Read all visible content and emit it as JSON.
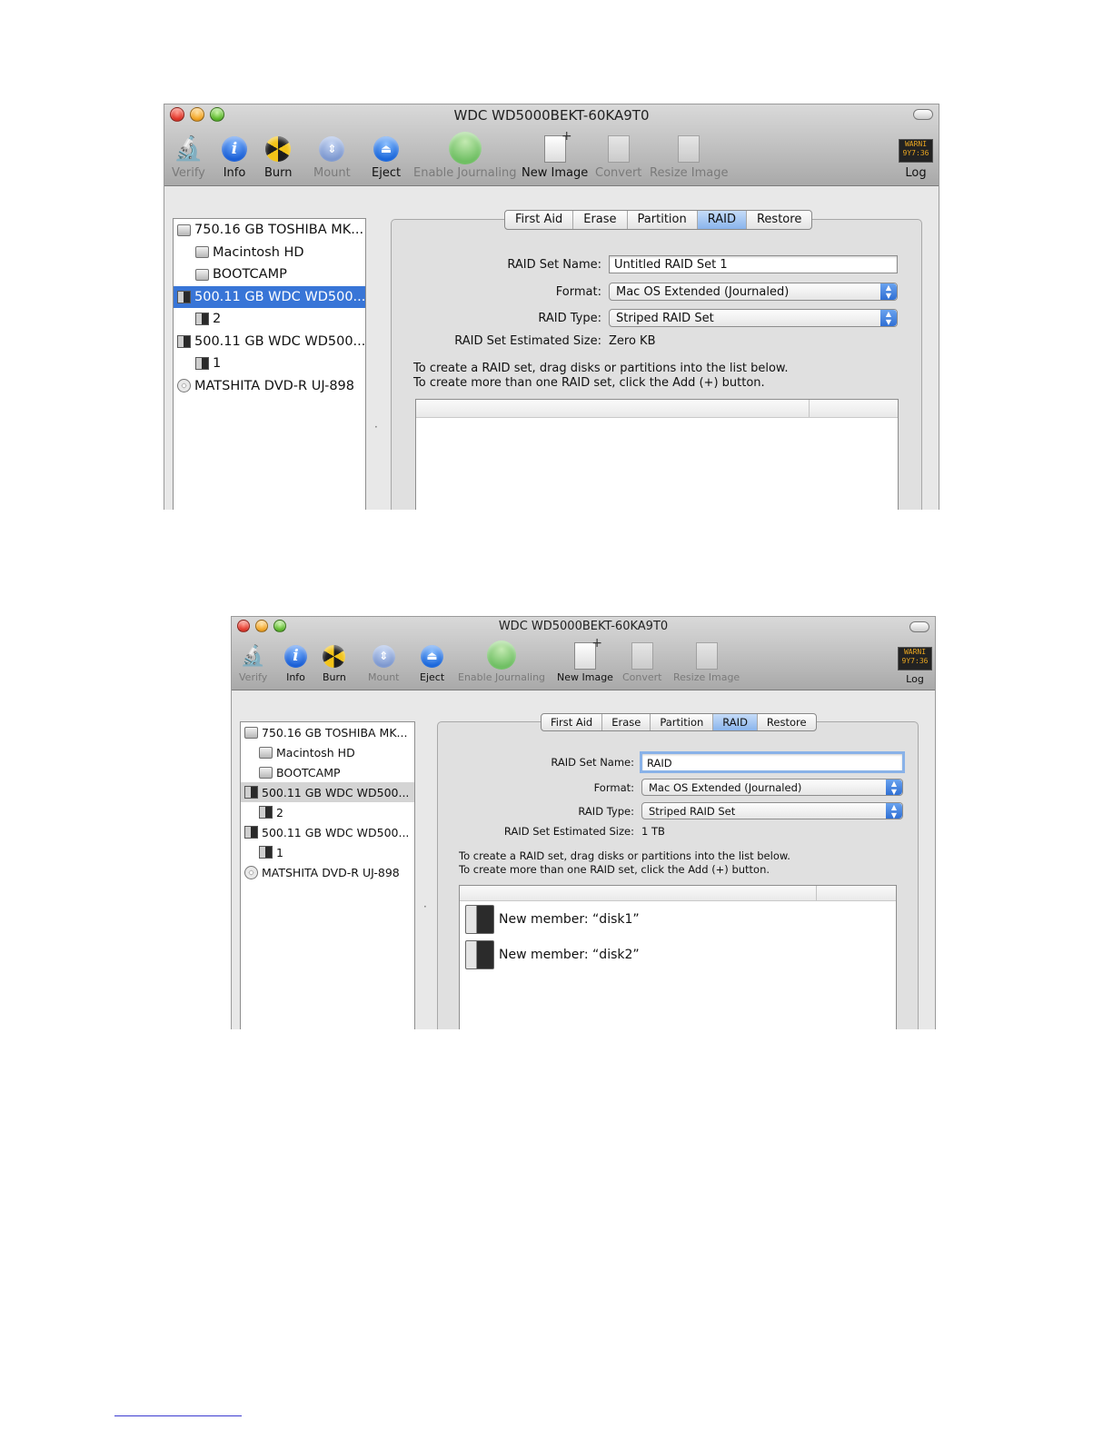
{
  "window1": {
    "title": "WDC WD5000BEKT-60KA9T0",
    "toolbar": [
      {
        "label": "Verify",
        "icon": "microscope-icon",
        "enabled": false
      },
      {
        "label": "Info",
        "icon": "info-icon",
        "enabled": true
      },
      {
        "label": "Burn",
        "icon": "burn-icon",
        "enabled": true
      },
      {
        "label": "Mount",
        "icon": "mount-icon",
        "enabled": false
      },
      {
        "label": "Eject",
        "icon": "eject-icon",
        "enabled": true
      },
      {
        "label": "Enable Journaling",
        "icon": "journaling-icon",
        "enabled": false
      },
      {
        "label": "New Image",
        "icon": "new-image-icon",
        "enabled": true
      },
      {
        "label": "Convert",
        "icon": "convert-icon",
        "enabled": false
      },
      {
        "label": "Resize Image",
        "icon": "resize-image-icon",
        "enabled": false
      },
      {
        "label": "Log",
        "icon": "log-icon",
        "enabled": true
      }
    ],
    "log_icon_text": "WARNI\n9Y7:36",
    "sidebar": [
      {
        "label": "750.16 GB TOSHIBA MK...",
        "icon": "internal-disk-icon",
        "indent": false,
        "selected": false
      },
      {
        "label": "Macintosh HD",
        "icon": "volume-icon",
        "indent": true,
        "selected": false
      },
      {
        "label": "BOOTCAMP",
        "icon": "volume-icon",
        "indent": true,
        "selected": false
      },
      {
        "label": "500.11 GB WDC WD500...",
        "icon": "external-disk-icon",
        "indent": false,
        "selected": true
      },
      {
        "label": "2",
        "icon": "external-volume-icon",
        "indent": true,
        "selected": false
      },
      {
        "label": "500.11 GB WDC WD500...",
        "icon": "external-disk-icon",
        "indent": false,
        "selected": false
      },
      {
        "label": "1",
        "icon": "external-volume-icon",
        "indent": true,
        "selected": false
      },
      {
        "label": "MATSHITA DVD-R UJ-898",
        "icon": "optical-disc-icon",
        "indent": false,
        "selected": false
      }
    ],
    "tabs": [
      "First Aid",
      "Erase",
      "Partition",
      "RAID",
      "Restore"
    ],
    "active_tab": "RAID",
    "raid": {
      "set_name_label": "RAID Set Name:",
      "set_name_value": "Untitled RAID Set 1",
      "format_label": "Format:",
      "format_value": "Mac OS Extended (Journaled)",
      "type_label": "RAID Type:",
      "type_value": "Striped RAID Set",
      "size_label": "RAID Set Estimated Size:",
      "size_value": "Zero KB",
      "help_line1": "To create a RAID set, drag disks or partitions into the list below.",
      "help_line2": "To create more than one RAID set, click the Add (+) button.",
      "members": []
    }
  },
  "window2": {
    "title": "WDC WD5000BEKT-60KA9T0",
    "toolbar": [
      {
        "label": "Verify",
        "icon": "microscope-icon",
        "enabled": false
      },
      {
        "label": "Info",
        "icon": "info-icon",
        "enabled": true
      },
      {
        "label": "Burn",
        "icon": "burn-icon",
        "enabled": true
      },
      {
        "label": "Mount",
        "icon": "mount-icon",
        "enabled": false
      },
      {
        "label": "Eject",
        "icon": "eject-icon",
        "enabled": true
      },
      {
        "label": "Enable Journaling",
        "icon": "journaling-icon",
        "enabled": false
      },
      {
        "label": "New Image",
        "icon": "new-image-icon",
        "enabled": true
      },
      {
        "label": "Convert",
        "icon": "convert-icon",
        "enabled": false
      },
      {
        "label": "Resize Image",
        "icon": "resize-image-icon",
        "enabled": false
      },
      {
        "label": "Log",
        "icon": "log-icon",
        "enabled": true
      }
    ],
    "log_icon_text": "WARNI\n9Y7:36",
    "sidebar": [
      {
        "label": "750.16 GB TOSHIBA MK...",
        "icon": "internal-disk-icon",
        "indent": false,
        "selected": false
      },
      {
        "label": "Macintosh HD",
        "icon": "volume-icon",
        "indent": true,
        "selected": false
      },
      {
        "label": "BOOTCAMP",
        "icon": "volume-icon",
        "indent": true,
        "selected": false
      },
      {
        "label": "500.11 GB WDC WD500...",
        "icon": "external-disk-icon",
        "indent": false,
        "selected": true
      },
      {
        "label": "2",
        "icon": "external-volume-icon",
        "indent": true,
        "selected": false
      },
      {
        "label": "500.11 GB WDC WD500...",
        "icon": "external-disk-icon",
        "indent": false,
        "selected": false
      },
      {
        "label": "1",
        "icon": "external-volume-icon",
        "indent": true,
        "selected": false
      },
      {
        "label": "MATSHITA DVD-R UJ-898",
        "icon": "optical-disc-icon",
        "indent": false,
        "selected": false
      }
    ],
    "tabs": [
      "First Aid",
      "Erase",
      "Partition",
      "RAID",
      "Restore"
    ],
    "active_tab": "RAID",
    "raid": {
      "set_name_label": "RAID Set Name:",
      "set_name_value": "RAID",
      "format_label": "Format:",
      "format_value": "Mac OS Extended (Journaled)",
      "type_label": "RAID Type:",
      "type_value": "Striped RAID Set",
      "size_label": "RAID Set Estimated Size:",
      "size_value": "1 TB",
      "help_line1": "To create a RAID set, drag disks or partitions into the list below.",
      "help_line2": "To create more than one RAID set, click the Add (+) button.",
      "members": [
        {
          "label": "New member: “disk1”",
          "icon": "disk-member-icon"
        },
        {
          "label": "New member: “disk2”",
          "icon": "disk-member-icon"
        }
      ]
    }
  },
  "colors": {
    "selection": "#3875d7",
    "active_tab": "#89b4ec"
  }
}
